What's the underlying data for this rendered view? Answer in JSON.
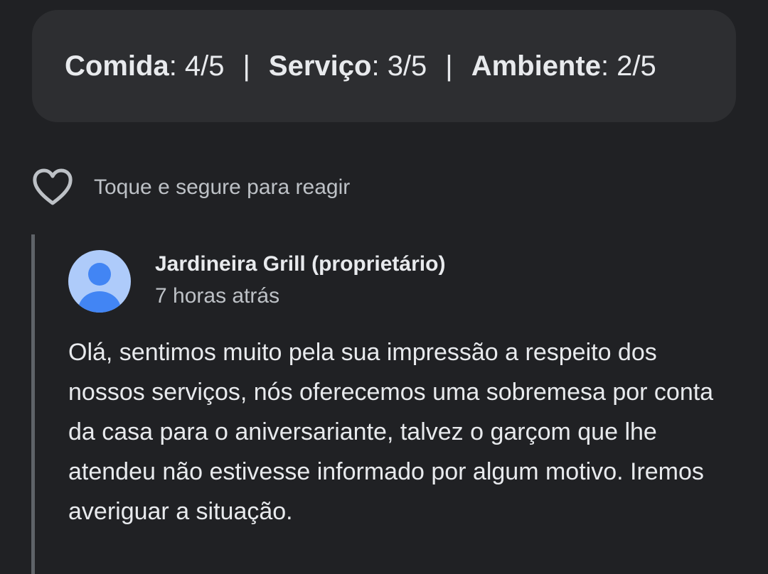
{
  "ratings": {
    "food_label": "Comida",
    "food_value": "4/5",
    "service_label": "Serviço",
    "service_value": "3/5",
    "ambience_label": "Ambiente",
    "ambience_value": "2/5",
    "separator": "|"
  },
  "reaction": {
    "icon": "heart-outline-icon",
    "hint": "Toque e segure para reagir"
  },
  "owner_reply": {
    "avatar_icon": "person-avatar-icon",
    "avatar_color": "#aecbfa",
    "avatar_figure_color": "#4285f4",
    "name": "Jardineira Grill (proprietário)",
    "time": "7 horas atrás",
    "text": "Olá, sentimos muito pela sua impressão a respeito dos nossos serviços, nós oferecemos uma sobremesa por conta da casa para o aniversariante, talvez o garçom que lhe atendeu não estivesse informado por algum motivo. Iremos averiguar a situação."
  },
  "colors": {
    "background": "#202124",
    "card": "#2d2e31",
    "text": "#e8eaed",
    "muted_text": "#bdc1c6"
  }
}
